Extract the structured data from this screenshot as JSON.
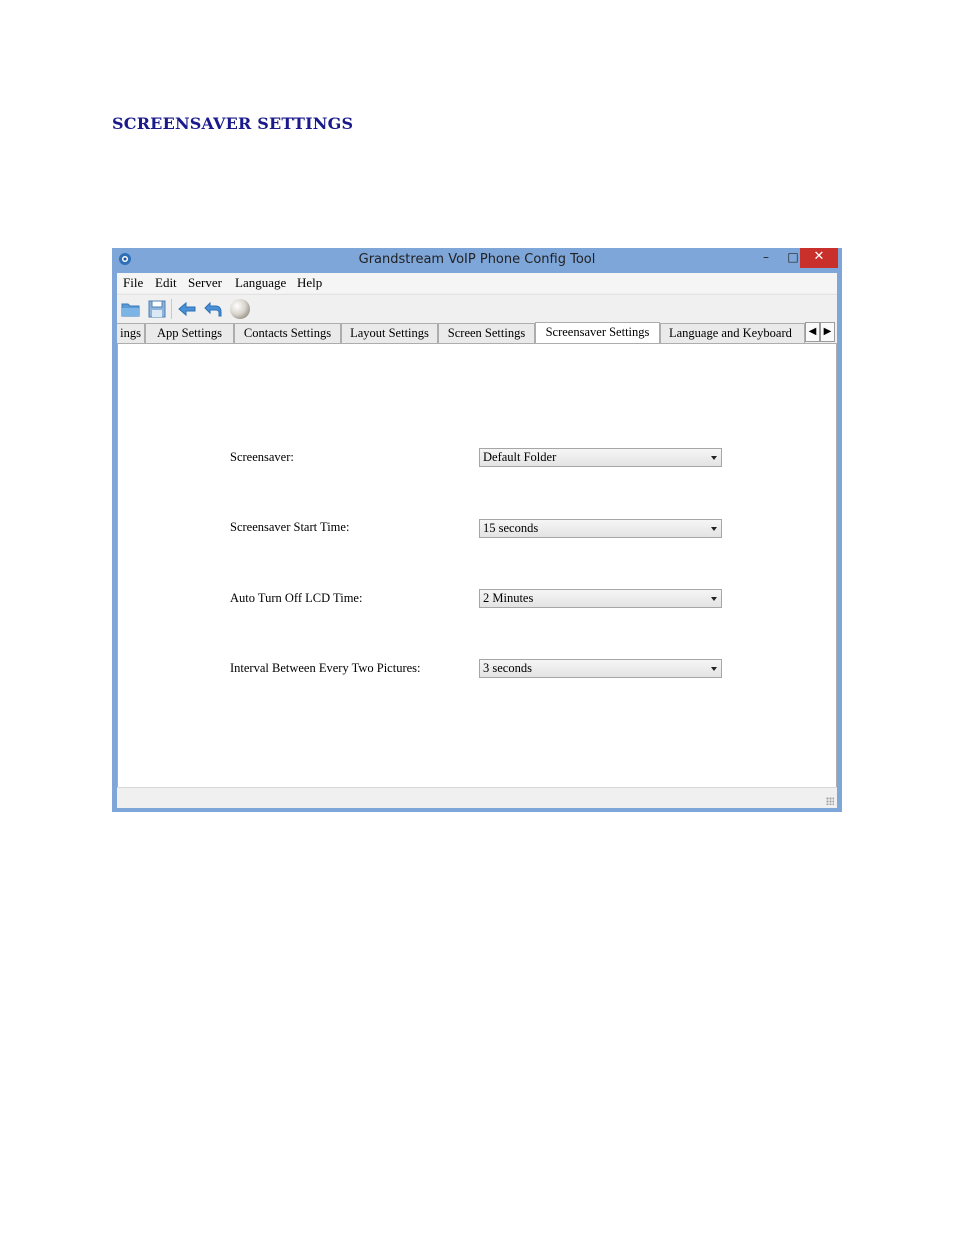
{
  "document": {
    "heading": "SCREENSAVER SETTINGS"
  },
  "window": {
    "title": "Grandstream VoIP Phone Config Tool",
    "controls": {
      "minimize": "–",
      "maximize": "□",
      "close": "✕"
    },
    "colors": {
      "frame": "#7ea6d9",
      "close": "#c9302c",
      "heading": "#1a1a8c"
    }
  },
  "menubar": {
    "items": [
      "File",
      "Edit",
      "Server",
      "Language",
      "Help"
    ]
  },
  "toolbar": {
    "icons": [
      "open-folder-icon",
      "save-icon",
      "back-arrow-icon",
      "undo-icon",
      "sphere-icon"
    ]
  },
  "tabs": {
    "items": [
      "ings",
      "App Settings",
      "Contacts Settings",
      "Layout Settings",
      "Screen Settings",
      "Screensaver Settings",
      "Language and Keyboard"
    ],
    "active": "Screensaver Settings",
    "scroll_left": "◀",
    "scroll_right": "▶"
  },
  "fields": [
    {
      "label": "Screensaver:",
      "value": "Default Folder"
    },
    {
      "label": "Screensaver Start Time:",
      "value": "15 seconds"
    },
    {
      "label": "Auto Turn Off LCD Time:",
      "value": "2 Minutes"
    },
    {
      "label": "Interval Between Every Two Pictures:",
      "value": "3 seconds"
    }
  ]
}
